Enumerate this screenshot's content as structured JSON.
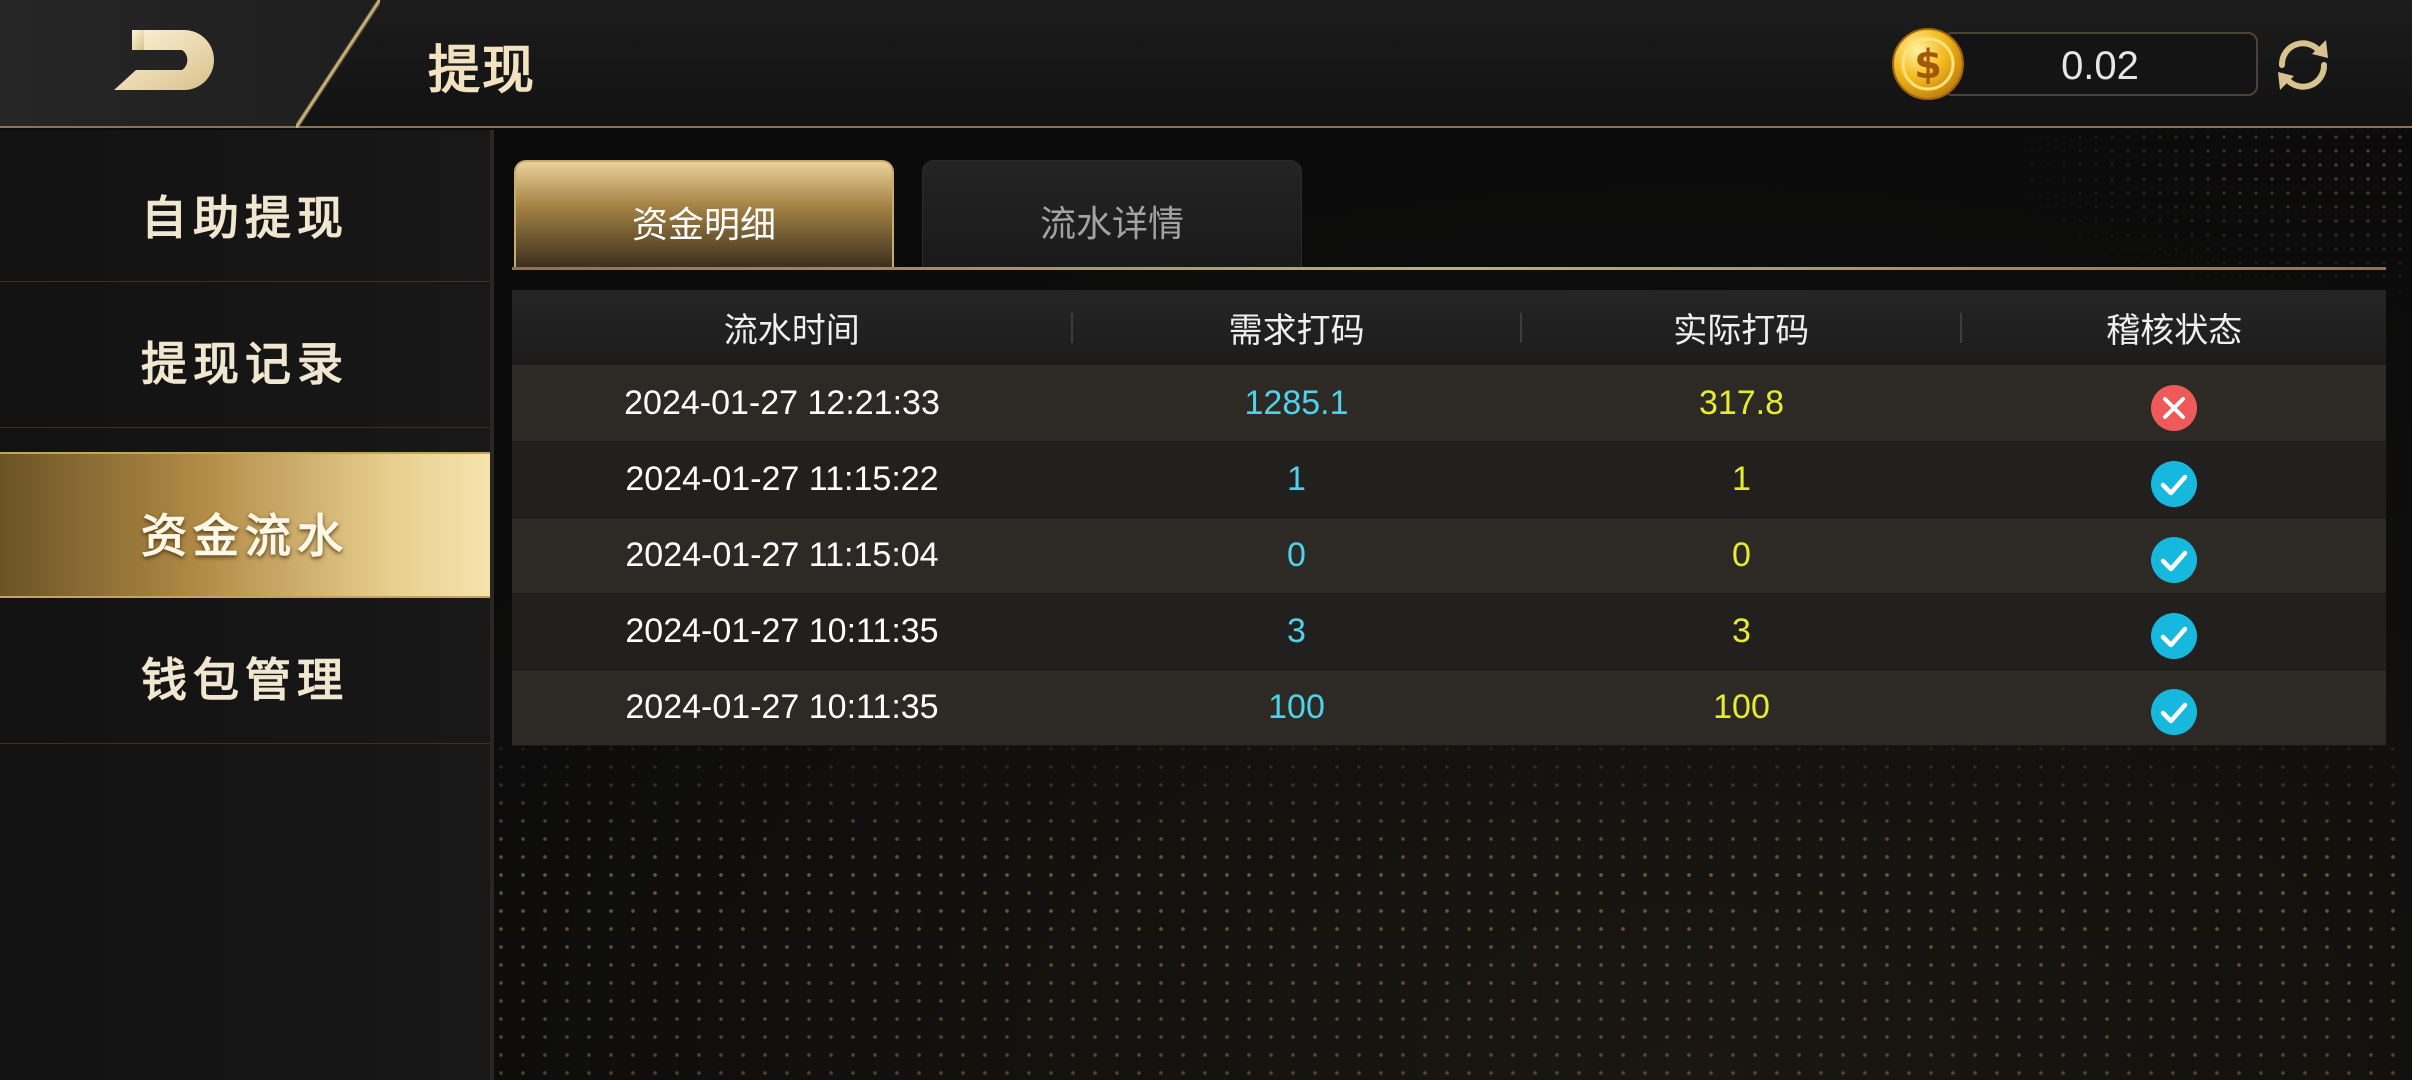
{
  "header": {
    "title": "提现",
    "balance": "0.02",
    "icons": {
      "back": "back-arrow-icon",
      "coin": "coin-icon",
      "refresh": "refresh-icon"
    }
  },
  "sidebar": {
    "items": [
      {
        "label": "自助提现",
        "active": false
      },
      {
        "label": "提现记录",
        "active": false
      },
      {
        "label": "资金流水",
        "active": true
      },
      {
        "label": "钱包管理",
        "active": false
      }
    ]
  },
  "tabs": [
    {
      "label": "资金明细",
      "active": true
    },
    {
      "label": "流水详情",
      "active": false
    }
  ],
  "table": {
    "columns": [
      "流水时间",
      "需求打码",
      "实际打码",
      "稽核状态"
    ],
    "rows": [
      {
        "time": "2024-01-27 12:21:33",
        "required": "1285.1",
        "actual": "317.8",
        "status": "fail"
      },
      {
        "time": "2024-01-27 11:15:22",
        "required": "1",
        "actual": "1",
        "status": "pass"
      },
      {
        "time": "2024-01-27 11:15:04",
        "required": "0",
        "actual": "0",
        "status": "pass"
      },
      {
        "time": "2024-01-27 10:11:35",
        "required": "3",
        "actual": "3",
        "status": "pass"
      },
      {
        "time": "2024-01-27 10:11:35",
        "required": "100",
        "actual": "100",
        "status": "pass"
      }
    ]
  },
  "colors": {
    "gold": "#c8ac6e",
    "required_text": "#4fd2e9",
    "actual_text": "#e8ec2e",
    "status_pass": "#17b8de",
    "status_fail": "#ee5a5a"
  }
}
